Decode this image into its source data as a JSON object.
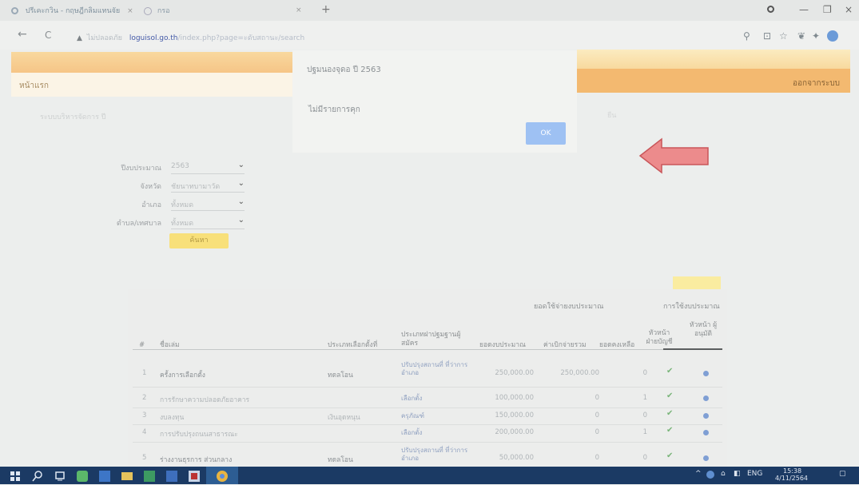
{
  "browser": {
    "tab_title": "ปรีเคะกวิน - กฤษฎีกลิมแทนจัย",
    "tab_close": "×",
    "tab2_title": "กรอ",
    "tab2_close": "×",
    "new_tab": "+",
    "window_controls": [
      "—",
      "❐",
      "×"
    ],
    "back": "←",
    "reload": "C",
    "address_warning": "▲",
    "address_prefix": "ไม่ปลอดภัย",
    "address_host": "loguisol.go.th",
    "address_rest": "/index.php?page=ะดับสถานะ/search"
  },
  "header": {
    "home_link": "หน้าแรก",
    "logout_link": "ออกจากระบบ"
  },
  "dialog": {
    "line1": "ปฐมนองจุดอ ปี 2563",
    "line2": "ไม่มีรายการคุก",
    "ok_label": "OK"
  },
  "faint_text": {
    "left": "ระบบบริหารจัดการ ปี",
    "right": "ยืน"
  },
  "filters": [
    {
      "label": "ปีงบประมาณ",
      "value": "2563"
    },
    {
      "label": "จังหวัด",
      "value": "ชัยนาทบามาวัด"
    },
    {
      "label": "อำเภอ",
      "value": "ทั้งหมด"
    },
    {
      "label": "ตำบล/เทศบาล",
      "value": "ทั้งหมด"
    }
  ],
  "search_button": "ค้นหา",
  "table": {
    "caption_budget": "ยอดใช้จ่ายงบประมาณ",
    "caption_count": "การใช้งบประมาณ",
    "headers": [
      "#",
      "ชื่อเล่ม",
      "ประเภทเลือกตั้งที่",
      "ประเภทฝาปฐมฐานผู้สมัคร",
      "ยอดงบประมาณ",
      "ค่าเบิกจ่ายรวม",
      "ยอดคงเหลือ",
      "หัวหน้า ฝ่ายบัญชี",
      "หัวหน้า ผู้อนุมัติ"
    ],
    "rows": [
      {
        "no": "1",
        "name": "ครั้งการเลือกตั้ง",
        "type": "ทดลโอน",
        "category": "ปรับปรุงสถานที่ ที่ว่าการอำเภอ",
        "budget": "250,000.00",
        "spent": "250,000.00",
        "remain": "0",
        "check": "✔",
        "view": "view"
      },
      {
        "no": "2",
        "name": "การรักษาความปลอดภัยอาคาร",
        "type": "",
        "category": "เลือกตั้ง",
        "budget": "100,000.00",
        "spent": "0",
        "remain": "1",
        "check": "✔",
        "view": "view"
      },
      {
        "no": "3",
        "name": "งบลงทุน",
        "type": "เงินอุดหนุน",
        "category": "ครุภัณฑ์",
        "budget": "150,000.00",
        "spent": "0",
        "remain": "0",
        "check": "✔",
        "view": "view"
      },
      {
        "no": "4",
        "name": "การปรับปรุงถนนสาธารณะ",
        "type": "",
        "category": "เลือกตั้ง",
        "budget": "200,000.00",
        "spent": "0",
        "remain": "1",
        "check": "✔",
        "view": "view"
      },
      {
        "no": "5",
        "name": "ร่างงานธุรการ ส่วนกลาง",
        "type": "ทดลโอน",
        "category": "ปรับปรุงสถานที่ ที่ว่าการอำเภอ",
        "budget": "50,000.00",
        "spent": "0",
        "remain": "0",
        "check": "✔",
        "view": "view"
      }
    ]
  },
  "taskbar": {
    "lang": "ENG",
    "time": "15:38",
    "date": "4/11/2564"
  },
  "colors": {
    "banner": "#f6c587",
    "ok_button": "#9ec1f3",
    "arrow": "#e4797c",
    "taskbar": "#1b3a64"
  }
}
